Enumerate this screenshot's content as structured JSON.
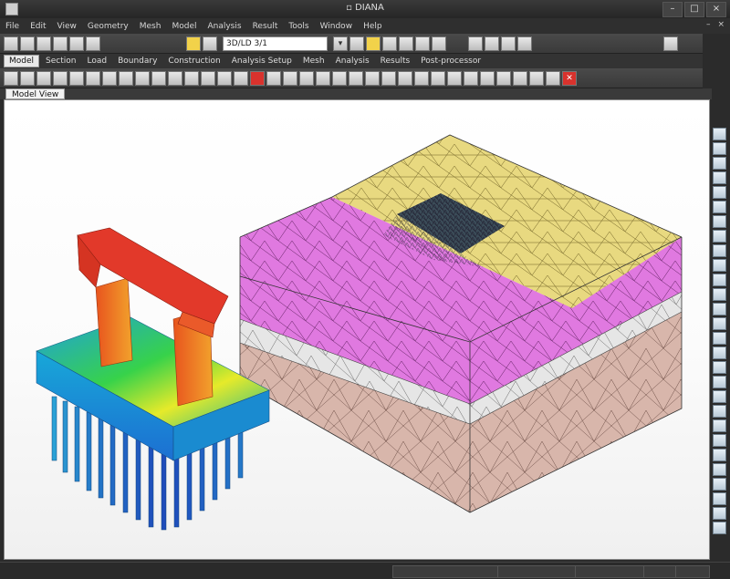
{
  "window": {
    "title": "▫ DIANA"
  },
  "menubar": {
    "items": [
      "File",
      "Edit",
      "View",
      "Geometry",
      "Mesh",
      "Model",
      "Analysis",
      "Result",
      "Tools",
      "Window",
      "Help"
    ]
  },
  "toolbar1": {
    "combo_value": "3D/LD 3/1"
  },
  "model_tabs": [
    "Model",
    "Section",
    "Load",
    "Boundary",
    "Construction",
    "Analysis Setup",
    "Mesh",
    "Analysis",
    "Results",
    "Post-processor"
  ],
  "view_tab": "Model View",
  "icons": {
    "minimize": "minimize-icon",
    "maximize": "maximize-icon",
    "close": "close-icon"
  },
  "colors": {
    "clay": "#d8b6ab",
    "silt": "#e6e6e6",
    "sand": "#e079e0",
    "top": "#e8d980"
  }
}
